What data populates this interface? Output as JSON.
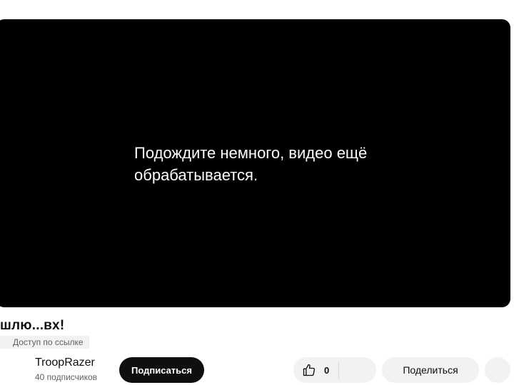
{
  "player": {
    "message": "Подождите немного, видео ещё обрабатывается."
  },
  "video": {
    "title": "шлю...вх!",
    "access": "Доступ по ссылке"
  },
  "channel": {
    "name": "TroopRazer",
    "subscribers": "40 подписчиков",
    "subscribe_label": "Подписаться"
  },
  "actions": {
    "like_count": "0",
    "share_label": "Поделиться"
  },
  "colors": {
    "player_bg": "#000000",
    "subscribe_bg": "#0f0f0f",
    "chip_bg": "#f2f2f2"
  }
}
